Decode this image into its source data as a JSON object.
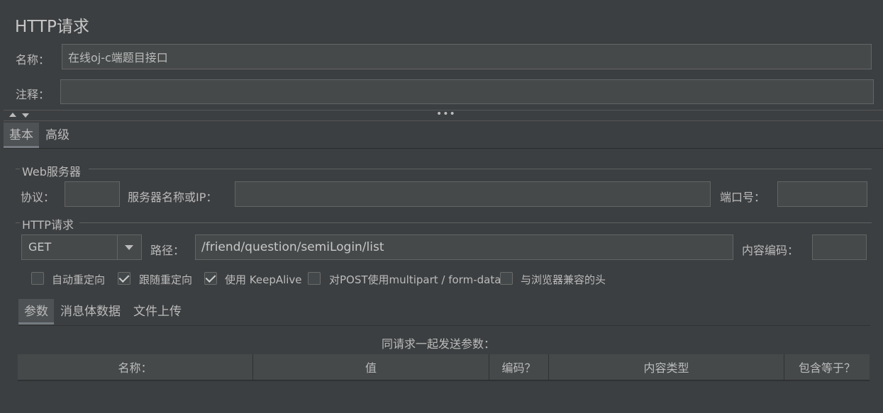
{
  "window": {
    "title": "HTTP请求"
  },
  "name_field": {
    "label": "名称：",
    "value": "在线oj-c端题目接口"
  },
  "comment_field": {
    "label": "注释：",
    "value": ""
  },
  "main_tabs": [
    {
      "label": "基本",
      "active": true
    },
    {
      "label": "高级",
      "active": false
    }
  ],
  "web_server": {
    "group_title": "Web服务器",
    "protocol_label": "协议：",
    "protocol_value": "",
    "server_label": "服务器名称或IP：",
    "server_value": "",
    "port_label": "端口号：",
    "port_value": ""
  },
  "http_request": {
    "group_title": "HTTP请求",
    "method": "GET",
    "path_label": "路径：",
    "path_value": "/friend/question/semiLogin/list",
    "encoding_label": "内容编码：",
    "encoding_value": ""
  },
  "options": [
    {
      "label": "自动重定向",
      "checked": false
    },
    {
      "label": "跟随重定向",
      "checked": true
    },
    {
      "label": "使用 KeepAlive",
      "checked": true
    },
    {
      "label": "对POST使用multipart / form-data",
      "checked": false
    },
    {
      "label": "与浏览器兼容的头",
      "checked": false
    }
  ],
  "sub_tabs": [
    {
      "label": "参数",
      "active": true
    },
    {
      "label": "消息体数据",
      "active": false
    },
    {
      "label": "文件上传",
      "active": false
    }
  ],
  "params_table": {
    "caption": "同请求一起发送参数：",
    "columns": [
      "名称：",
      "值",
      "编码？",
      "内容类型",
      "包含等于？"
    ]
  },
  "colors": {
    "background": "#3c3f41",
    "field": "#45494a",
    "text": "#bbbbbb"
  }
}
